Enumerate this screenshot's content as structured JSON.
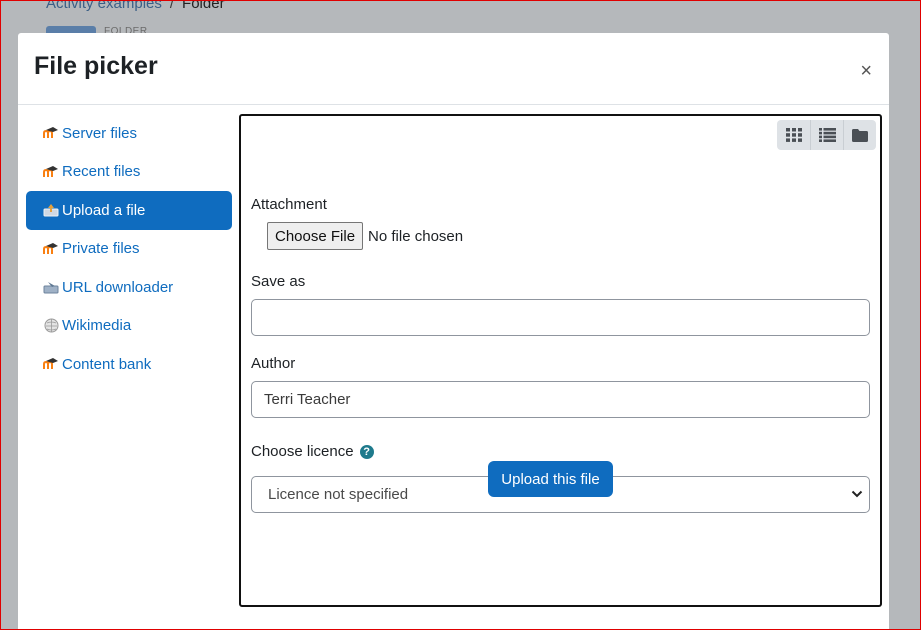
{
  "background": {
    "breadcrumb": {
      "parent": "Activity examples",
      "separator": "/",
      "current": "Folder"
    },
    "folder_label": "FOLDER"
  },
  "modal": {
    "title": "File picker",
    "close_label": "×"
  },
  "sidebar": {
    "items": [
      {
        "label": "Server files",
        "icon": "moodle-icon",
        "active": false
      },
      {
        "label": "Recent files",
        "icon": "moodle-icon",
        "active": false
      },
      {
        "label": "Upload a file",
        "icon": "upload-icon",
        "active": true
      },
      {
        "label": "Private files",
        "icon": "moodle-icon",
        "active": false
      },
      {
        "label": "URL downloader",
        "icon": "url-download-icon",
        "active": false
      },
      {
        "label": "Wikimedia",
        "icon": "wikimedia-icon",
        "active": false
      },
      {
        "label": "Content bank",
        "icon": "moodle-icon",
        "active": false
      }
    ]
  },
  "view_toggle": {
    "buttons": [
      "grid-view-icon",
      "list-view-icon",
      "folder-view-icon"
    ]
  },
  "form": {
    "attachment_label": "Attachment",
    "choose_file_label": "Choose File",
    "no_file_text": "No file chosen",
    "save_as_label": "Save as",
    "save_as_value": "",
    "author_label": "Author",
    "author_value": "Terri Teacher",
    "licence_label": "Choose licence",
    "licence_selected": "Licence not specified",
    "upload_button": "Upload this file"
  },
  "colors": {
    "accent": "#0f6cbf",
    "help": "#1e7a8c",
    "frame": "#e00000"
  }
}
